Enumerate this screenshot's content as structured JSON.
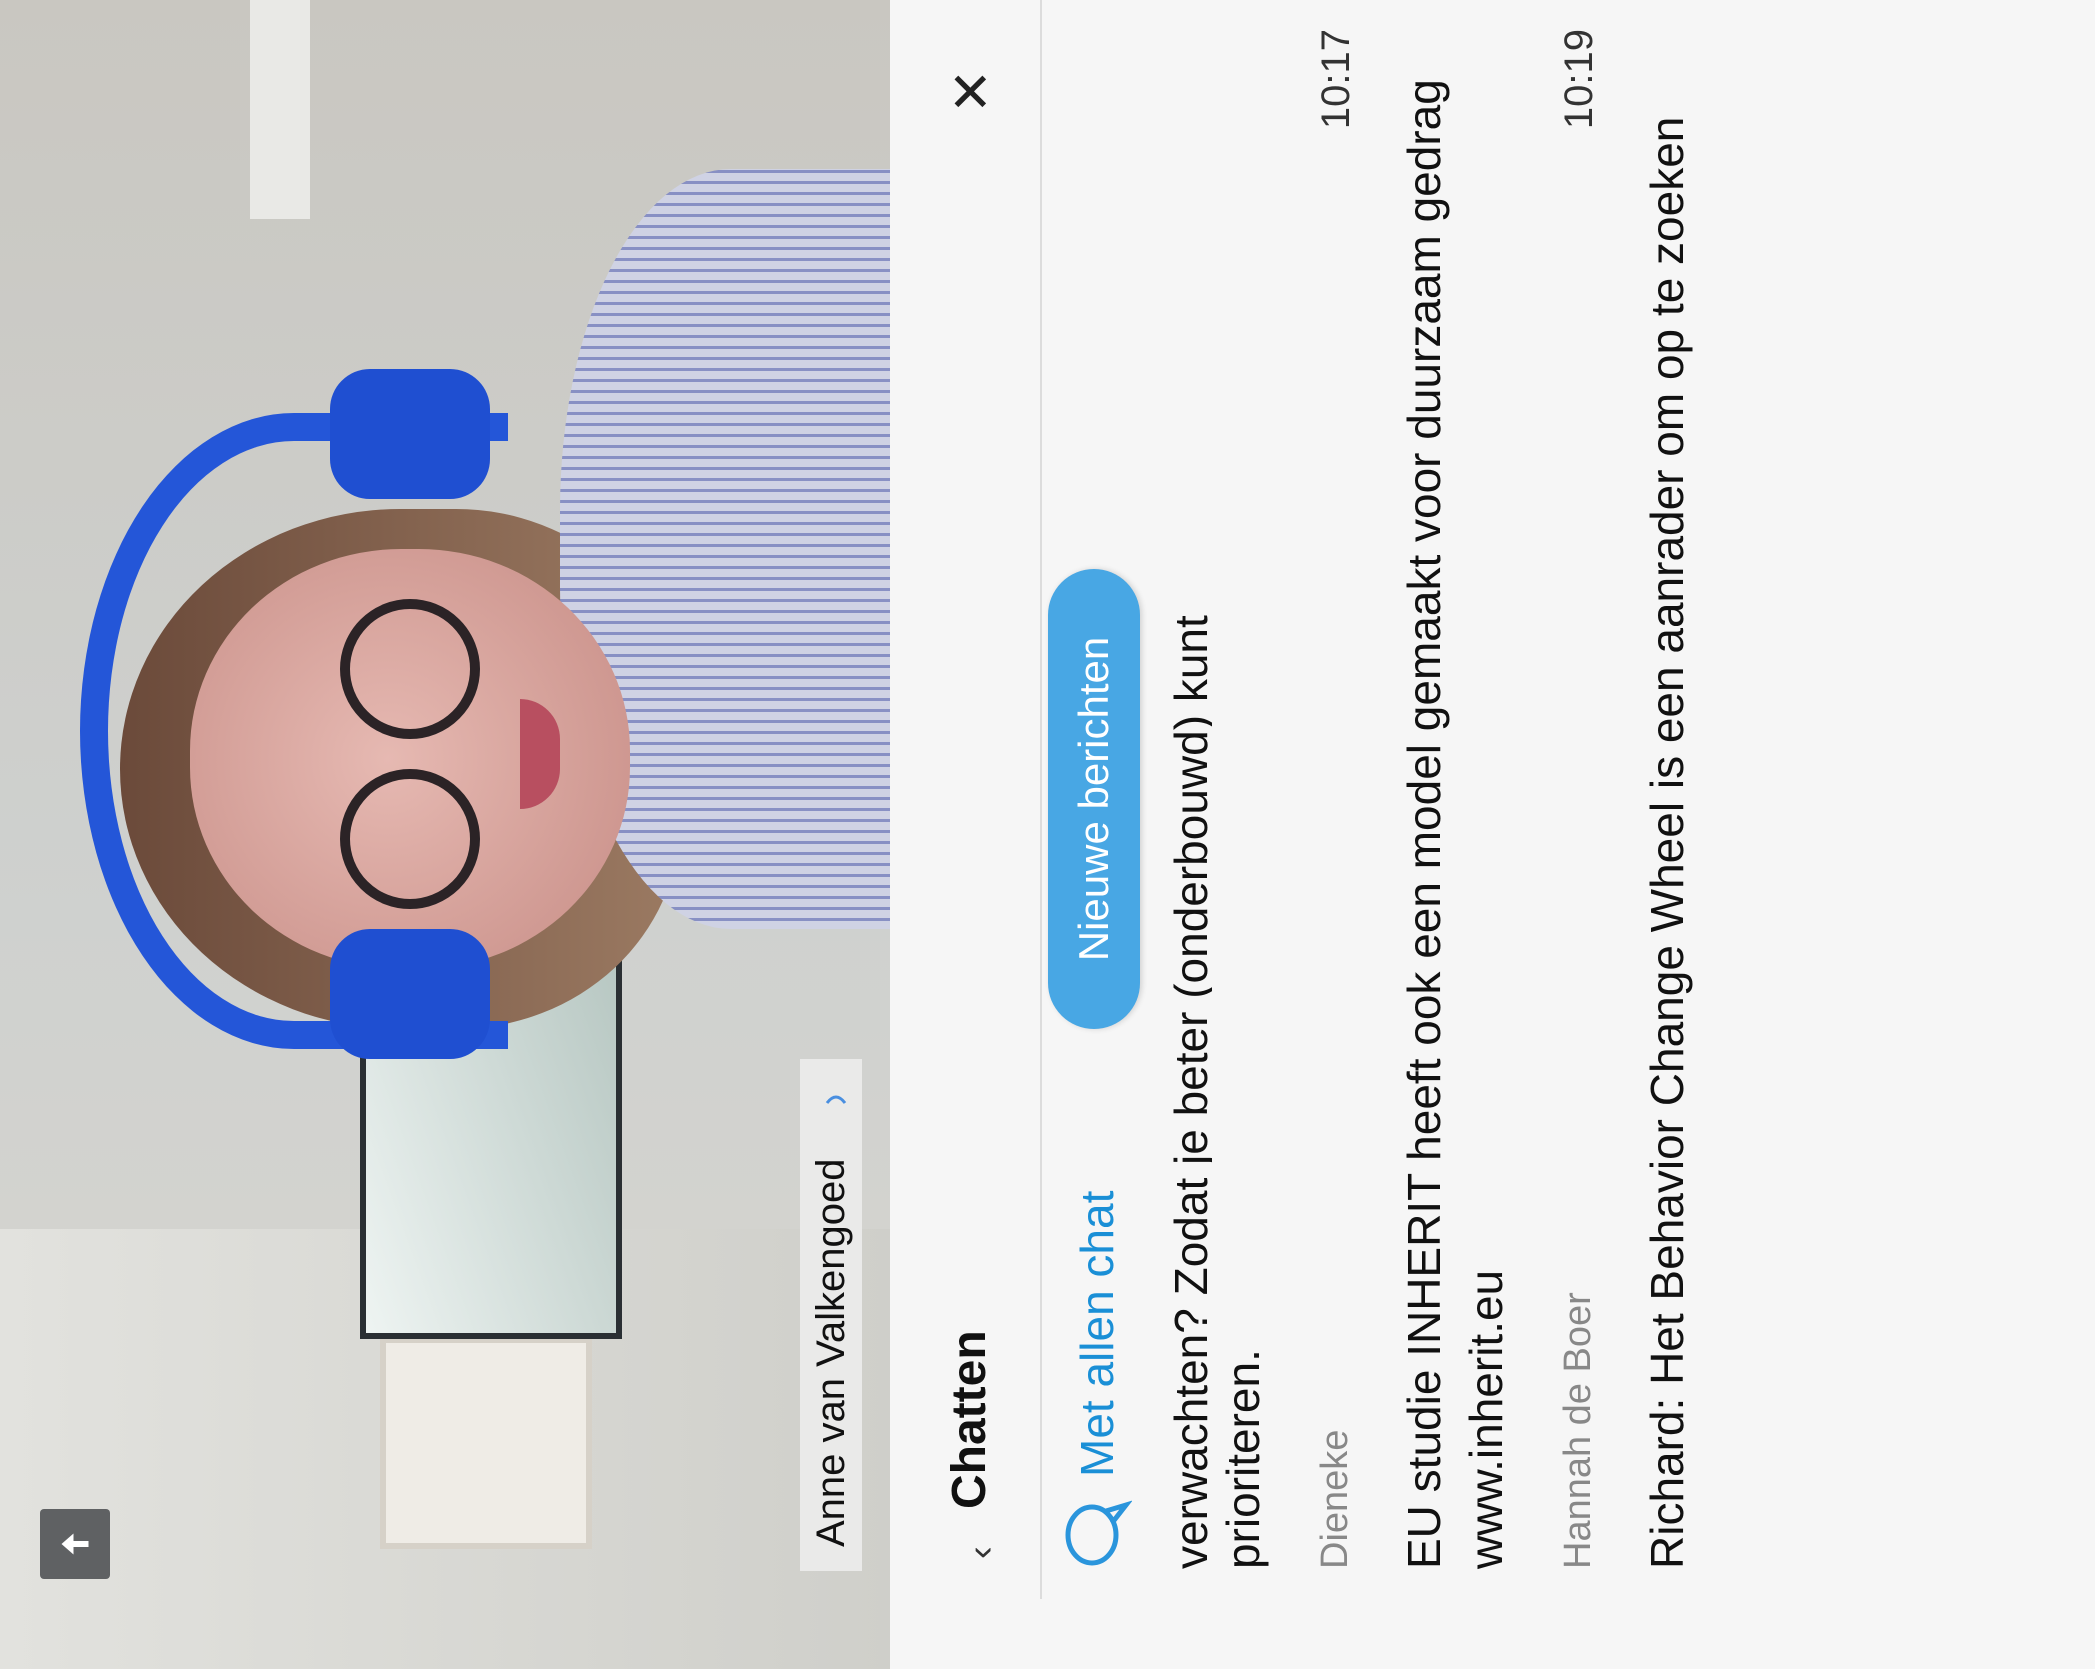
{
  "video": {
    "participant_name": "Anne van Valkengoed",
    "mic_icon": "microphone-icon"
  },
  "chat": {
    "title": "Chatten",
    "back_icon": "chevron-left-icon",
    "close_icon": "close-icon",
    "audience_label": "Met allen chat",
    "new_messages_button": "Nieuwe berichten",
    "partial_message": {
      "line1": "verwachten? Zodat je beter (onderbouwd) kunt",
      "line2": "prioriteren."
    },
    "messages": [
      {
        "sender": "Dieneke",
        "time": "10:17",
        "text": "EU studie INHERIT heeft ook een model gemaakt voor duurzaam gedrag www.inherit.eu"
      },
      {
        "sender": "Hannah de Boer",
        "time": "10:19",
        "text": "Richard: Het Behavior Change Wheel is een aanrader om op te zoeken"
      }
    ],
    "accent_color": "#1a8fd6",
    "button_color": "#48a7e4"
  }
}
